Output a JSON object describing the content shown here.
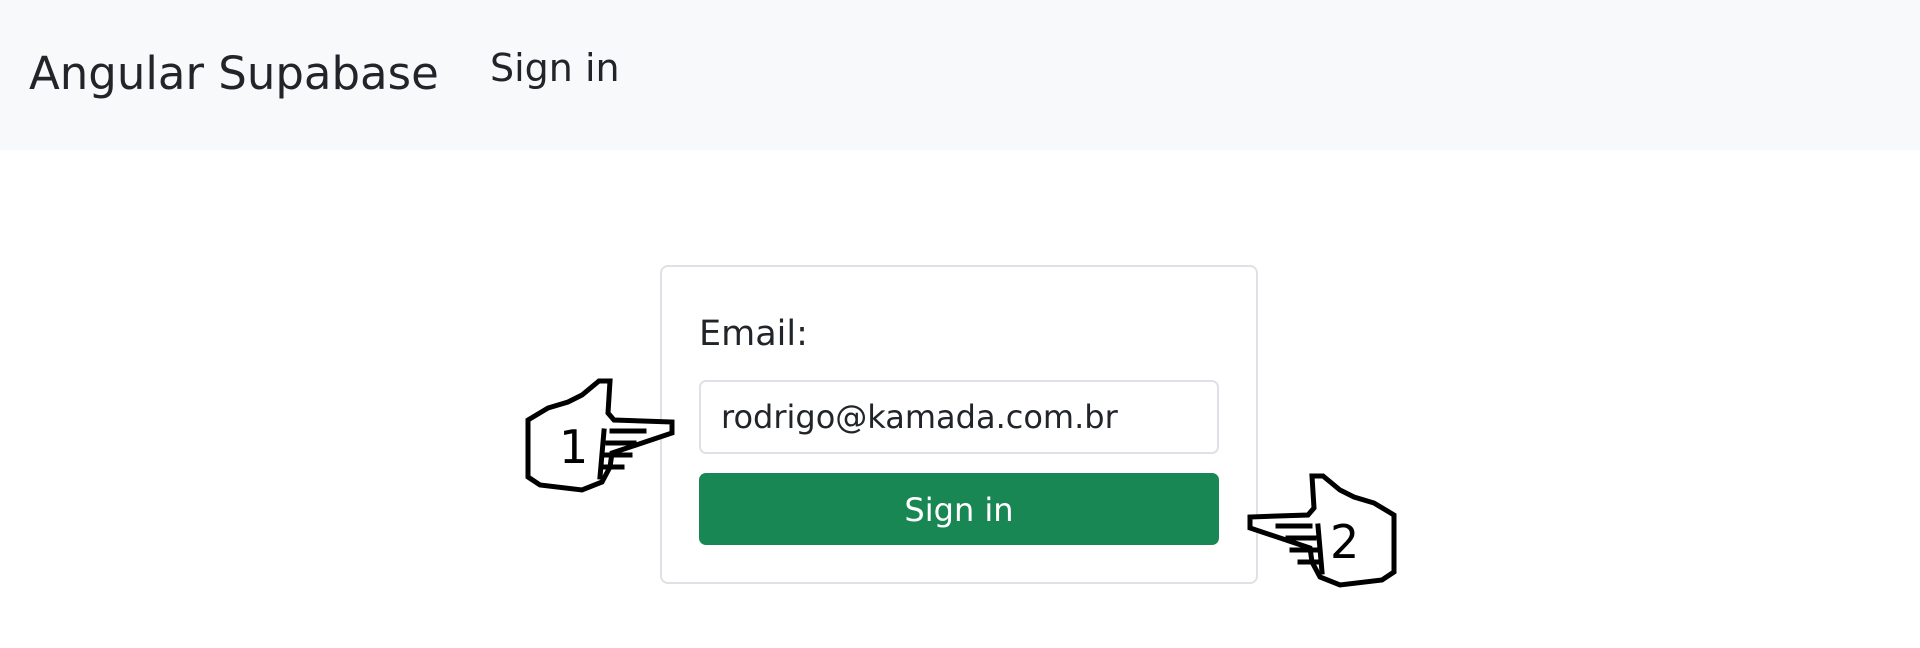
{
  "navbar": {
    "brand": "Angular Supabase",
    "link": "Sign in"
  },
  "form": {
    "email_label": "Email:",
    "email_value": "rodrigo@kamada.com.br",
    "submit_label": "Sign in"
  },
  "annotations": {
    "pointer_1": "1",
    "pointer_2": "2"
  },
  "colors": {
    "navbar_bg": "#f8f9fa",
    "button_bg": "#198754",
    "border": "#dee2e6"
  }
}
